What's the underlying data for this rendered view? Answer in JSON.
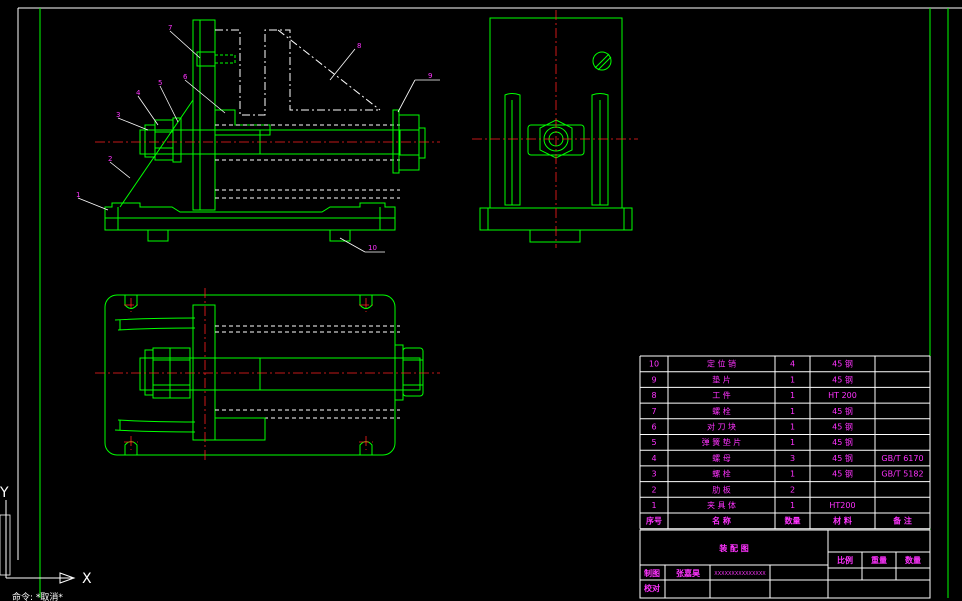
{
  "bom": {
    "rows": [
      {
        "no": "10",
        "name": "定 位 销",
        "qty": "4",
        "material": "45 钢",
        "note": ""
      },
      {
        "no": "9",
        "name": "垫 片",
        "qty": "1",
        "material": "45 钢",
        "note": ""
      },
      {
        "no": "8",
        "name": "工 件",
        "qty": "1",
        "material": "HT 200",
        "note": ""
      },
      {
        "no": "7",
        "name": "螺 栓",
        "qty": "1",
        "material": "45 钢",
        "note": ""
      },
      {
        "no": "6",
        "name": "对 刀 块",
        "qty": "1",
        "material": "45 钢",
        "note": ""
      },
      {
        "no": "5",
        "name": "弹 簧 垫 片",
        "qty": "1",
        "material": "45 钢",
        "note": ""
      },
      {
        "no": "4",
        "name": "螺 母",
        "qty": "3",
        "material": "45 钢",
        "note": "GB/T 6170"
      },
      {
        "no": "3",
        "name": "螺 栓",
        "qty": "1",
        "material": "45 钢",
        "note": "GB/T 5182"
      },
      {
        "no": "2",
        "name": "肋 板",
        "qty": "2",
        "material": "",
        "note": ""
      },
      {
        "no": "1",
        "name": "夹 具 体",
        "qty": "1",
        "material": "HT200",
        "note": ""
      }
    ],
    "header": {
      "no": "序号",
      "name": "名 称",
      "qty": "数量",
      "material": "材 料",
      "note": "备 注"
    }
  },
  "title_block": {
    "drawing_name": "装 配 图",
    "ratio_label": "比例",
    "weight_label": "重量",
    "count_label": "数量",
    "drawn_label": "制图",
    "drawn_name": "张嘉昊",
    "drawn_id": "XXXXXXXXXXXXXXX",
    "check_label": "校对"
  },
  "part_labels": [
    "1",
    "2",
    "3",
    "4",
    "5",
    "6",
    "7",
    "8",
    "9",
    "10"
  ],
  "ucs": {
    "x_label": "X",
    "y_label": "Y"
  },
  "command_line": "命令: *取消*"
}
